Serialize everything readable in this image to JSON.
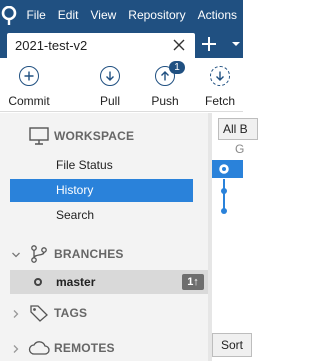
{
  "menu": {
    "items": [
      "File",
      "Edit",
      "View",
      "Repository",
      "Actions"
    ]
  },
  "tab": {
    "title": "2021-test-v2"
  },
  "toolbar": {
    "commit_label": "Commit",
    "pull_label": "Pull",
    "push_label": "Push",
    "push_badge": "1",
    "fetch_label": "Fetch"
  },
  "sidebar": {
    "workspace_label": "WORKSPACE",
    "workspace_items": [
      "File Status",
      "History",
      "Search"
    ],
    "selected_item": "History",
    "branches_label": "BRANCHES",
    "branch": {
      "name": "master",
      "ahead": "1↑"
    },
    "tags_label": "TAGS",
    "remotes_label": "REMOTES"
  },
  "right_panel": {
    "branch_filter": "All B",
    "graph_header": "G",
    "sort_label": "Sort"
  },
  "colors": {
    "brand": "#205081",
    "selection": "#2a82da",
    "sidebar_bg": "#f3f3f3"
  }
}
